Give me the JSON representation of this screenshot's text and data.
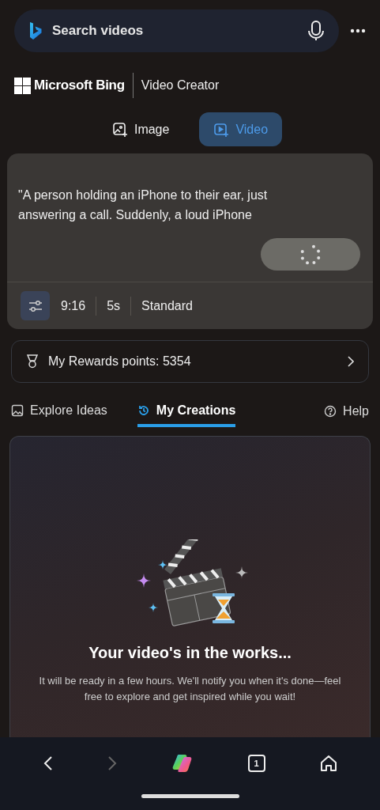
{
  "search": {
    "placeholder": "Search videos"
  },
  "brand": {
    "name": "Microsoft Bing",
    "product": "Video Creator"
  },
  "mode_tabs": [
    {
      "label": "Image",
      "kind": "image",
      "selected": false
    },
    {
      "label": "Video",
      "kind": "video",
      "selected": true
    }
  ],
  "prompt": {
    "text": "\"A person holding an iPhone to their ear, just answering a call. Suddenly, a loud iPhone",
    "generating": true
  },
  "options": [
    "9:16",
    "5s",
    "Standard"
  ],
  "rewards": {
    "label": "My Rewards points: 5354"
  },
  "section_tabs": [
    {
      "label": "Explore Ideas",
      "kind": "explore",
      "selected": false
    },
    {
      "label": "My Creations",
      "kind": "creations",
      "selected": true
    }
  ],
  "help": "Help",
  "status": {
    "title": "Your video's in the works...",
    "message": "It will be ready in a few hours. We'll notify you when it's done—feel free to explore and get inspired while you wait!"
  },
  "nav": {
    "back_disabled": false,
    "forward_disabled": true,
    "tab_count": "1"
  }
}
